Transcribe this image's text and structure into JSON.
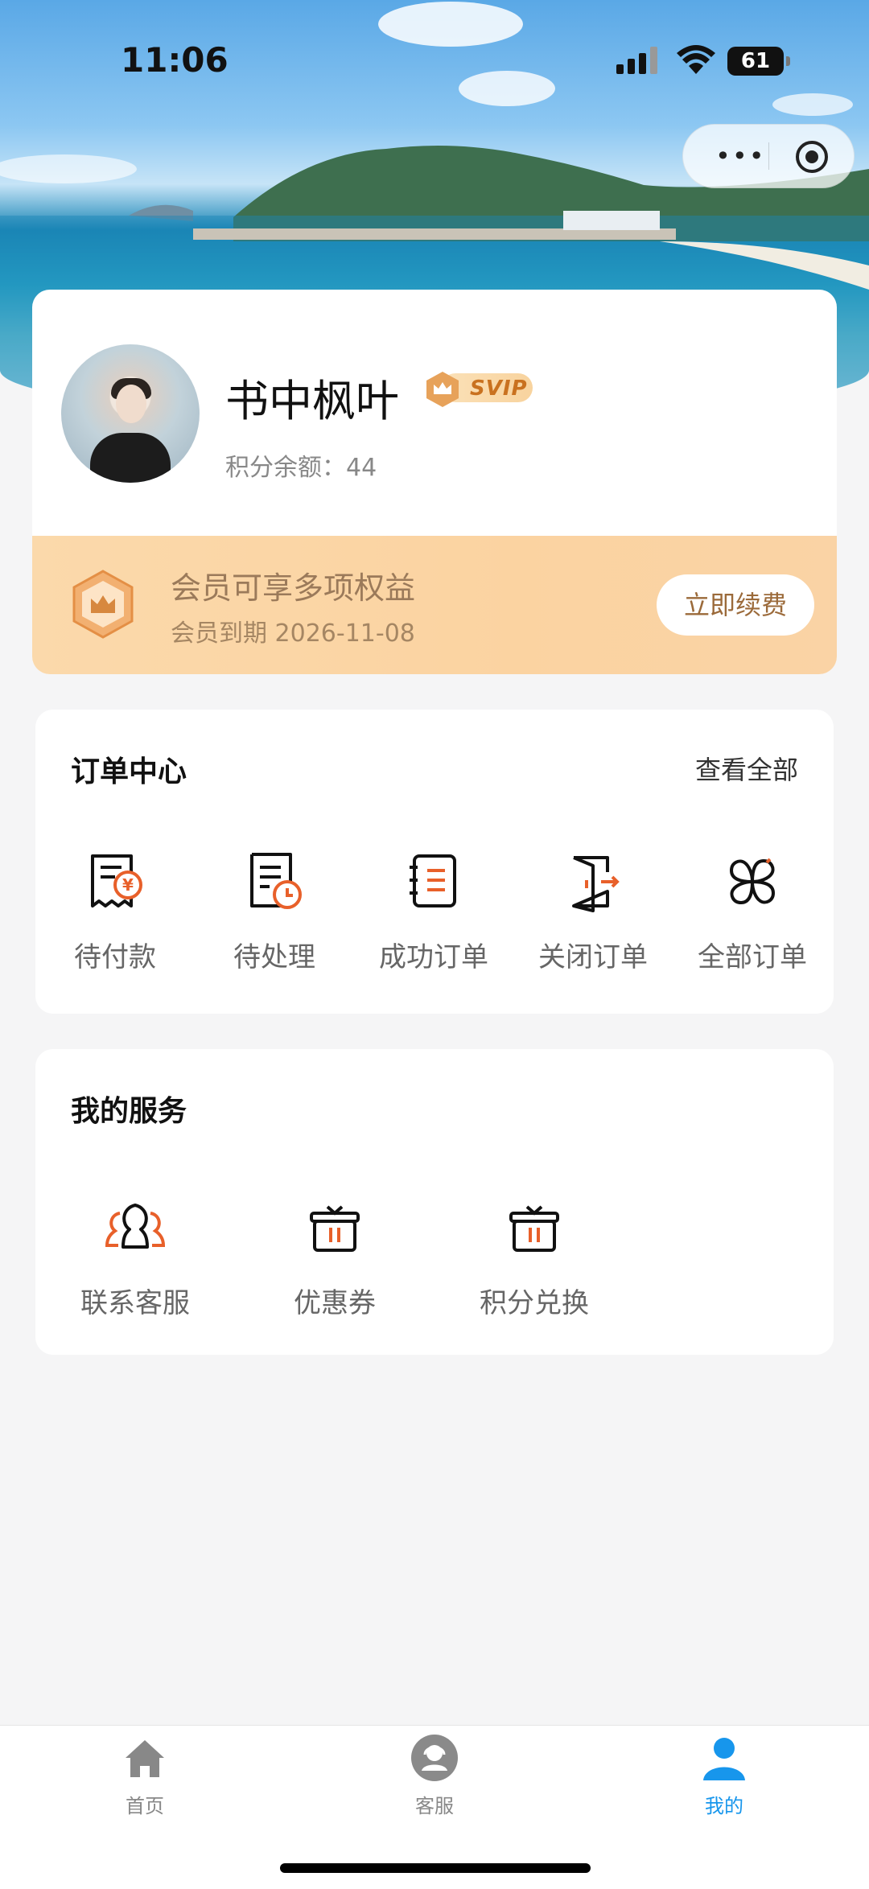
{
  "status_bar": {
    "time": "11:06",
    "battery": "61"
  },
  "capsule": {
    "more_icon": "more-dots-icon",
    "close_icon": "target-icon"
  },
  "profile": {
    "username": "书中枫叶",
    "badge": "SVIP",
    "points_text": "积分余额：44"
  },
  "vip": {
    "title": "会员可享多项权益",
    "expire_text": "会员到期 2026-11-08",
    "renew_label": "立即续费"
  },
  "orders": {
    "title": "订单中心",
    "see_all": "查看全部",
    "items": [
      {
        "label": "待付款",
        "icon": "pending-payment-icon"
      },
      {
        "label": "待处理",
        "icon": "pending-process-icon"
      },
      {
        "label": "成功订单",
        "icon": "success-order-icon"
      },
      {
        "label": "关闭订单",
        "icon": "closed-order-icon"
      },
      {
        "label": "全部订单",
        "icon": "all-orders-icon"
      }
    ]
  },
  "services": {
    "title": "我的服务",
    "items": [
      {
        "label": "联系客服",
        "icon": "customer-service-icon"
      },
      {
        "label": "优惠券",
        "icon": "coupon-gift-icon"
      },
      {
        "label": "积分兑换",
        "icon": "points-exchange-gift-icon"
      }
    ]
  },
  "tabbar": {
    "items": [
      {
        "label": "首页",
        "icon": "home-icon",
        "active": false
      },
      {
        "label": "客服",
        "icon": "support-icon",
        "active": false
      },
      {
        "label": "我的",
        "icon": "user-icon",
        "active": true
      }
    ]
  },
  "colors": {
    "accent": "#1796ec",
    "orange": "#e8602a",
    "gold": "#fbd9ab"
  }
}
